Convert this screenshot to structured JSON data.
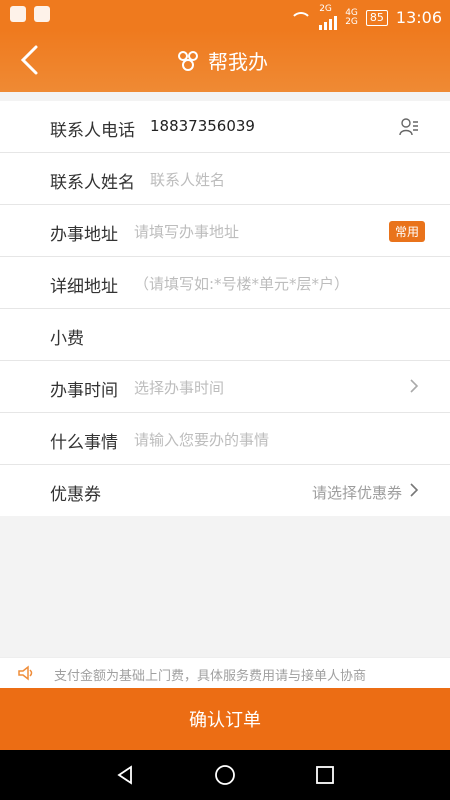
{
  "status": {
    "time": "13:06",
    "battery": "85",
    "net1": "2G",
    "net2": "4G",
    "net3": "2G"
  },
  "header": {
    "title": "帮我办"
  },
  "form": {
    "rows": [
      {
        "label": "联系人电话",
        "value": "18837356039"
      },
      {
        "label": "联系人姓名",
        "placeholder": "联系人姓名"
      },
      {
        "label": "办事地址",
        "placeholder": "请填写办事地址",
        "badge": "常用"
      },
      {
        "label": "详细地址",
        "placeholder": "（请填写如:*号楼*单元*层*户）"
      },
      {
        "label": "小费",
        "placeholder": ""
      },
      {
        "label": "办事时间",
        "placeholder": "选择办事时间"
      },
      {
        "label": "什么事情",
        "placeholder": "请输入您要办的事情"
      },
      {
        "label": "优惠券",
        "hint": "请选择优惠券"
      }
    ]
  },
  "notice": {
    "text": "支付金额为基础上门费，具体服务费用请与接单人协商"
  },
  "footer": {
    "confirm": "确认订单"
  },
  "icons": {
    "back": "back-arrow-icon",
    "title": "group-icon",
    "contact": "contact-book-icon",
    "chevron": "chevron-right-icon",
    "speaker": "speaker-icon"
  }
}
